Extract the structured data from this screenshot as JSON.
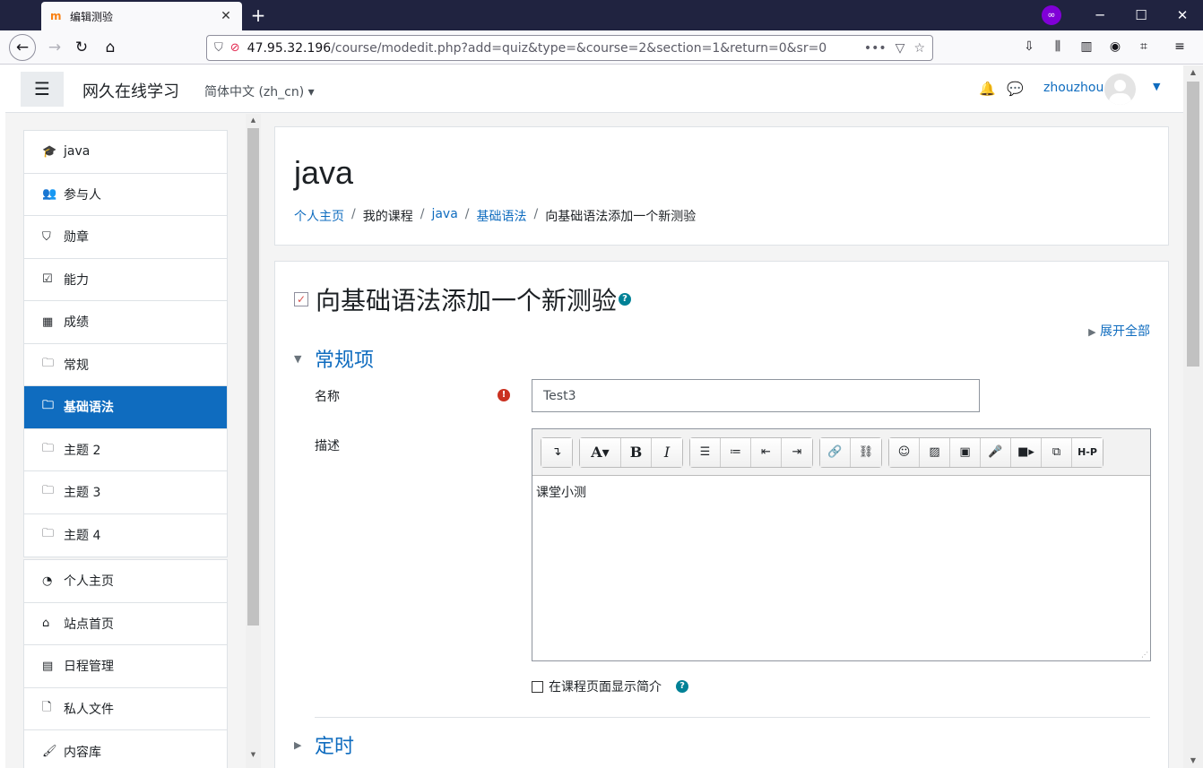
{
  "browser": {
    "tab_title": "编辑测验",
    "tab_favicon": "m",
    "url_host": "47.95.32.196",
    "url_path": "/course/modedit.php?add=quiz&type=&course=2&section=1&return=0&sr=0",
    "private_icon": "∞"
  },
  "header": {
    "site_name": "网久在线学习",
    "language": "简体中文 (zh_cn)",
    "username": "zhouzhou"
  },
  "drawer": {
    "course_items": [
      {
        "icon": "graduation-cap-icon",
        "glyph": "🎓",
        "label": "java"
      },
      {
        "icon": "users-icon",
        "glyph": "👥",
        "label": "参与人"
      },
      {
        "icon": "shield-icon",
        "glyph": "⛉",
        "label": "勋章"
      },
      {
        "icon": "check-square-icon",
        "glyph": "☑",
        "label": "能力"
      },
      {
        "icon": "table-icon",
        "glyph": "▦",
        "label": "成绩"
      },
      {
        "icon": "folder-icon",
        "glyph": "🗀",
        "label": "常规"
      },
      {
        "icon": "folder-icon",
        "glyph": "🗀",
        "label": "基础语法",
        "active": true
      },
      {
        "icon": "folder-icon",
        "glyph": "🗀",
        "label": "主题 2"
      },
      {
        "icon": "folder-icon",
        "glyph": "🗀",
        "label": "主题 3"
      },
      {
        "icon": "folder-icon",
        "glyph": "🗀",
        "label": "主题 4"
      }
    ],
    "site_items": [
      {
        "icon": "dashboard-icon",
        "glyph": "◔",
        "label": "个人主页"
      },
      {
        "icon": "home-icon",
        "glyph": "⌂",
        "label": "站点首页"
      },
      {
        "icon": "calendar-icon",
        "glyph": "▤",
        "label": "日程管理"
      },
      {
        "icon": "file-icon",
        "glyph": "🗋",
        "label": "私人文件"
      },
      {
        "icon": "paint-brush-icon",
        "glyph": "🖌",
        "label": "内容库"
      }
    ]
  },
  "course": {
    "title": "java",
    "breadcrumb": [
      {
        "label": "个人主页",
        "link": true
      },
      {
        "label": "我的课程",
        "link": false
      },
      {
        "label": "java",
        "link": true
      },
      {
        "label": "基础语法",
        "link": true
      },
      {
        "label": "向基础语法添加一个新测验",
        "link": false
      }
    ]
  },
  "form": {
    "title": "向基础语法添加一个新测验",
    "expand_all": "展开全部",
    "section_general": "常规项",
    "name_label": "名称",
    "name_value": "Test3",
    "description_label": "描述",
    "description_value": "课堂小测",
    "show_description_label": "在课程页面显示简介",
    "section_timing": "定时"
  },
  "colors": {
    "accent": "#0f6cbf",
    "required": "#ca3120",
    "help": "#008196"
  }
}
